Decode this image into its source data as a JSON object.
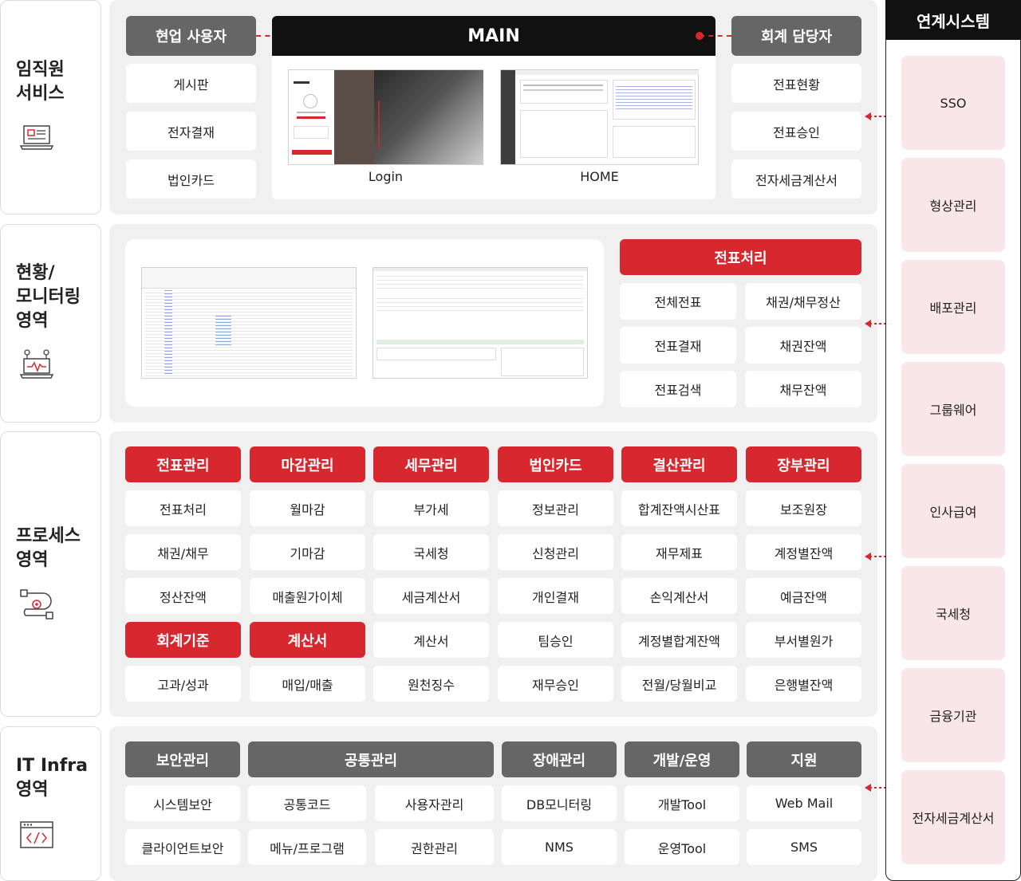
{
  "sections": {
    "employee": "임직원\n서비스",
    "monitoring": "현황/\n모니터링\n영역",
    "process": "프로세스\n영역",
    "infra": "IT Infra\n영역"
  },
  "employee": {
    "left_header": "현업 사용자",
    "left_items": [
      "게시판",
      "전자결재",
      "법인카드"
    ],
    "main_title": "MAIN",
    "login_label": "Login",
    "home_label": "HOME",
    "right_header": "회계 담당자",
    "right_items": [
      "전표현황",
      "전표승인",
      "전자세금계산서"
    ]
  },
  "monitoring": {
    "header": "전표처리",
    "items": [
      "전체전표",
      "채권/채무정산",
      "전표결재",
      "채권잔액",
      "전표검색",
      "채무잔액"
    ]
  },
  "process": {
    "headers": [
      "전표관리",
      "마감관리",
      "세무관리",
      "법인카드",
      "결산관리",
      "장부관리"
    ],
    "col1": [
      "전표처리",
      "채권/채무",
      "정산잔액"
    ],
    "col2": [
      "월마감",
      "기마감",
      "매출원가이체"
    ],
    "col3": [
      "부가세",
      "국세청",
      "세금계산서",
      "계산서",
      "원천징수"
    ],
    "col4": [
      "정보관리",
      "신청관리",
      "개인결재",
      "팀승인",
      "재무승인"
    ],
    "col5": [
      "합계잔액시산표",
      "재무제표",
      "손익계산서",
      "계정별합계잔액",
      "전월/당월비교"
    ],
    "col6": [
      "보조원장",
      "계정별잔액",
      "예금잔액",
      "부서별원가",
      "은행별잔액"
    ],
    "sub_headers": [
      "회계기준",
      "계산서"
    ],
    "sub_col1": [
      "고과/성과"
    ],
    "sub_col2": [
      "매입/매출"
    ]
  },
  "infra": {
    "headers": [
      "보안관리",
      "공통관리",
      "장애관리",
      "개발/운영",
      "지원"
    ],
    "security": [
      "시스템보안",
      "클라이언트보안"
    ],
    "common_a": [
      "공통코드",
      "메뉴/프로그램"
    ],
    "common_b": [
      "사용자관리",
      "권한관리"
    ],
    "failure": [
      "DB모니터링",
      "NMS"
    ],
    "devops": [
      "개발Tool",
      "운영Tool"
    ],
    "support": [
      "Web Mail",
      "SMS"
    ]
  },
  "systems": {
    "title": "연계시스템",
    "items": [
      "SSO",
      "형상관리",
      "배포관리",
      "그룹웨어",
      "인사급여",
      "국세청",
      "금융기관",
      "전자세금계산서"
    ]
  },
  "colors": {
    "accent_red": "#d7282f",
    "header_gray": "#666666",
    "panel_bg": "#f0f0f0",
    "system_bg": "#f9e6e8",
    "main_bar": "#111111"
  },
  "icons": [
    "laptop-document-icon",
    "laptop-monitoring-icon",
    "process-flow-icon",
    "code-window-icon",
    "bidirectional-arrow-icon"
  ]
}
